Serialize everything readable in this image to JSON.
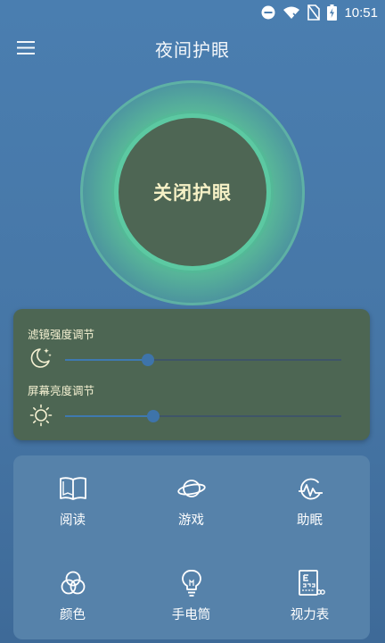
{
  "status_bar": {
    "time": "10:51",
    "icons": [
      "do-not-disturb-icon",
      "wifi-icon",
      "no-sim-icon",
      "battery-charging-icon"
    ]
  },
  "app_bar": {
    "title": "夜间护眼",
    "menu_icon": "hamburger-menu-icon"
  },
  "toggle": {
    "label": "关闭护眼"
  },
  "sliders": {
    "filter": {
      "label": "滤镜强度调节",
      "icon": "moon-stars-icon",
      "value": 0.3
    },
    "brightness": {
      "label": "屏幕亮度调节",
      "icon": "sun-icon",
      "value": 0.32
    }
  },
  "features": [
    {
      "label": "阅读",
      "icon": "book-icon"
    },
    {
      "label": "游戏",
      "icon": "planet-icon"
    },
    {
      "label": "助眠",
      "icon": "sleep-wave-icon"
    },
    {
      "label": "颜色",
      "icon": "color-circles-icon"
    },
    {
      "label": "手电筒",
      "icon": "lightbulb-icon"
    },
    {
      "label": "视力表",
      "icon": "eye-chart-icon"
    }
  ],
  "colors": {
    "background": "#4a7eb0",
    "toggle_ring": "#5cc9a2",
    "toggle_inner": "#4e6654",
    "card": "#4d6653",
    "slider_thumb": "#3e74aa",
    "text_warm": "#f6f1c6"
  }
}
